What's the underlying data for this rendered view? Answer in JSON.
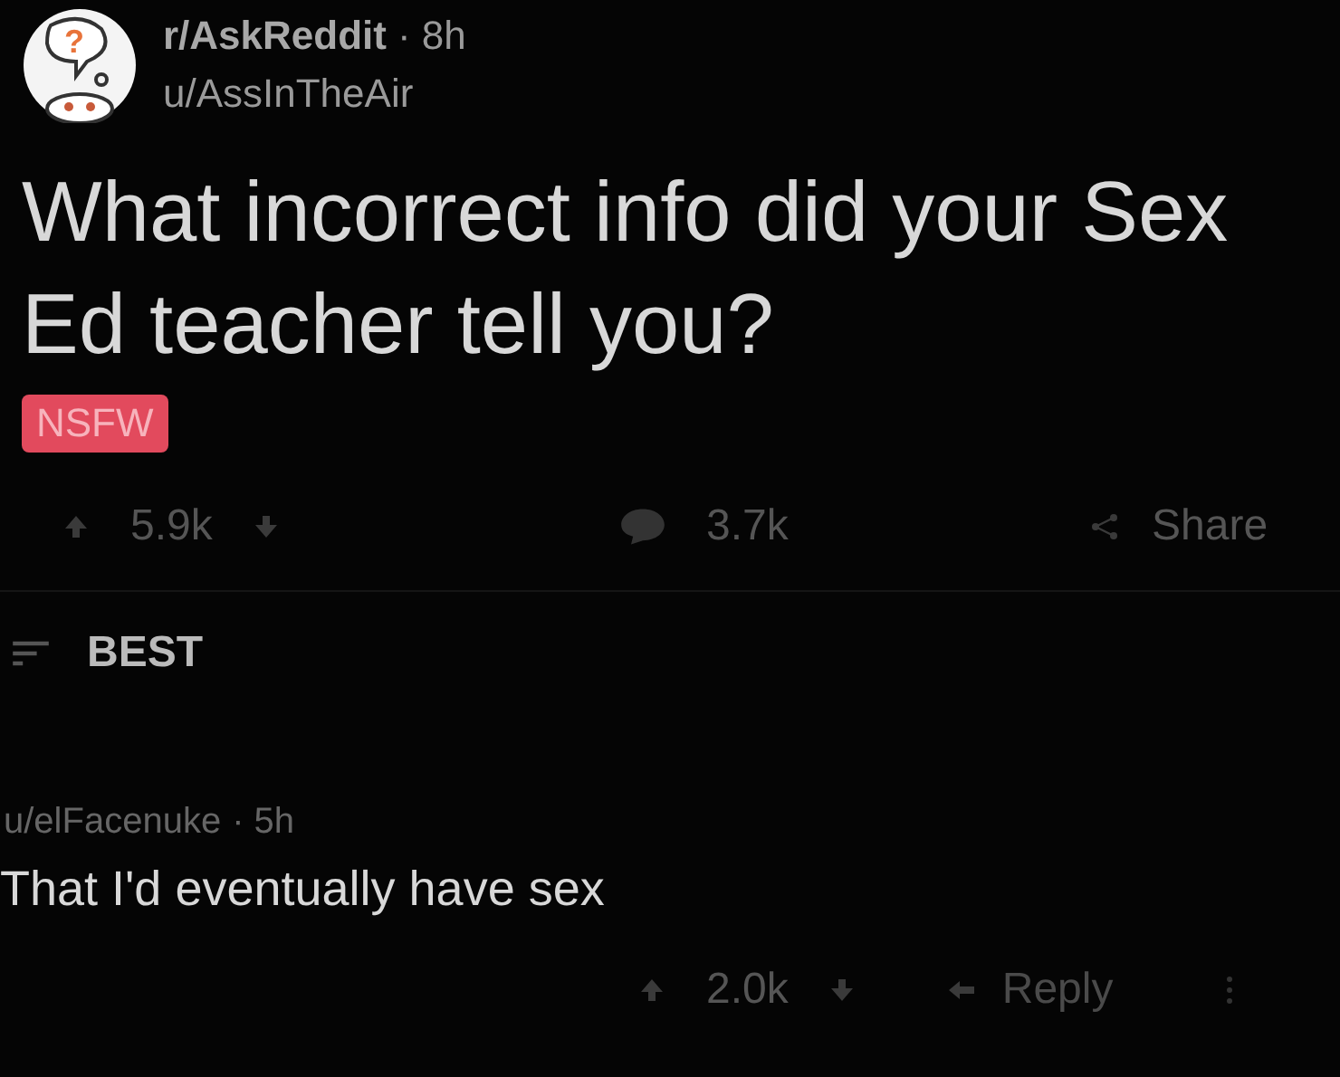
{
  "post": {
    "avatar_glyph": "?",
    "subreddit": "r/AskReddit",
    "age": "· 8h",
    "author": "u/AssInTheAir",
    "title": "What incorrect info did your Sex Ed teacher tell you?",
    "tag": "NSFW"
  },
  "actions": {
    "score": "5.9k",
    "comments": "3.7k",
    "share": "Share"
  },
  "sort": {
    "label": "BEST"
  },
  "comment": {
    "author": "u/elFacenuke",
    "age": "· 5h",
    "body": "That I'd eventually have sex",
    "score": "2.0k",
    "reply": "Reply"
  }
}
